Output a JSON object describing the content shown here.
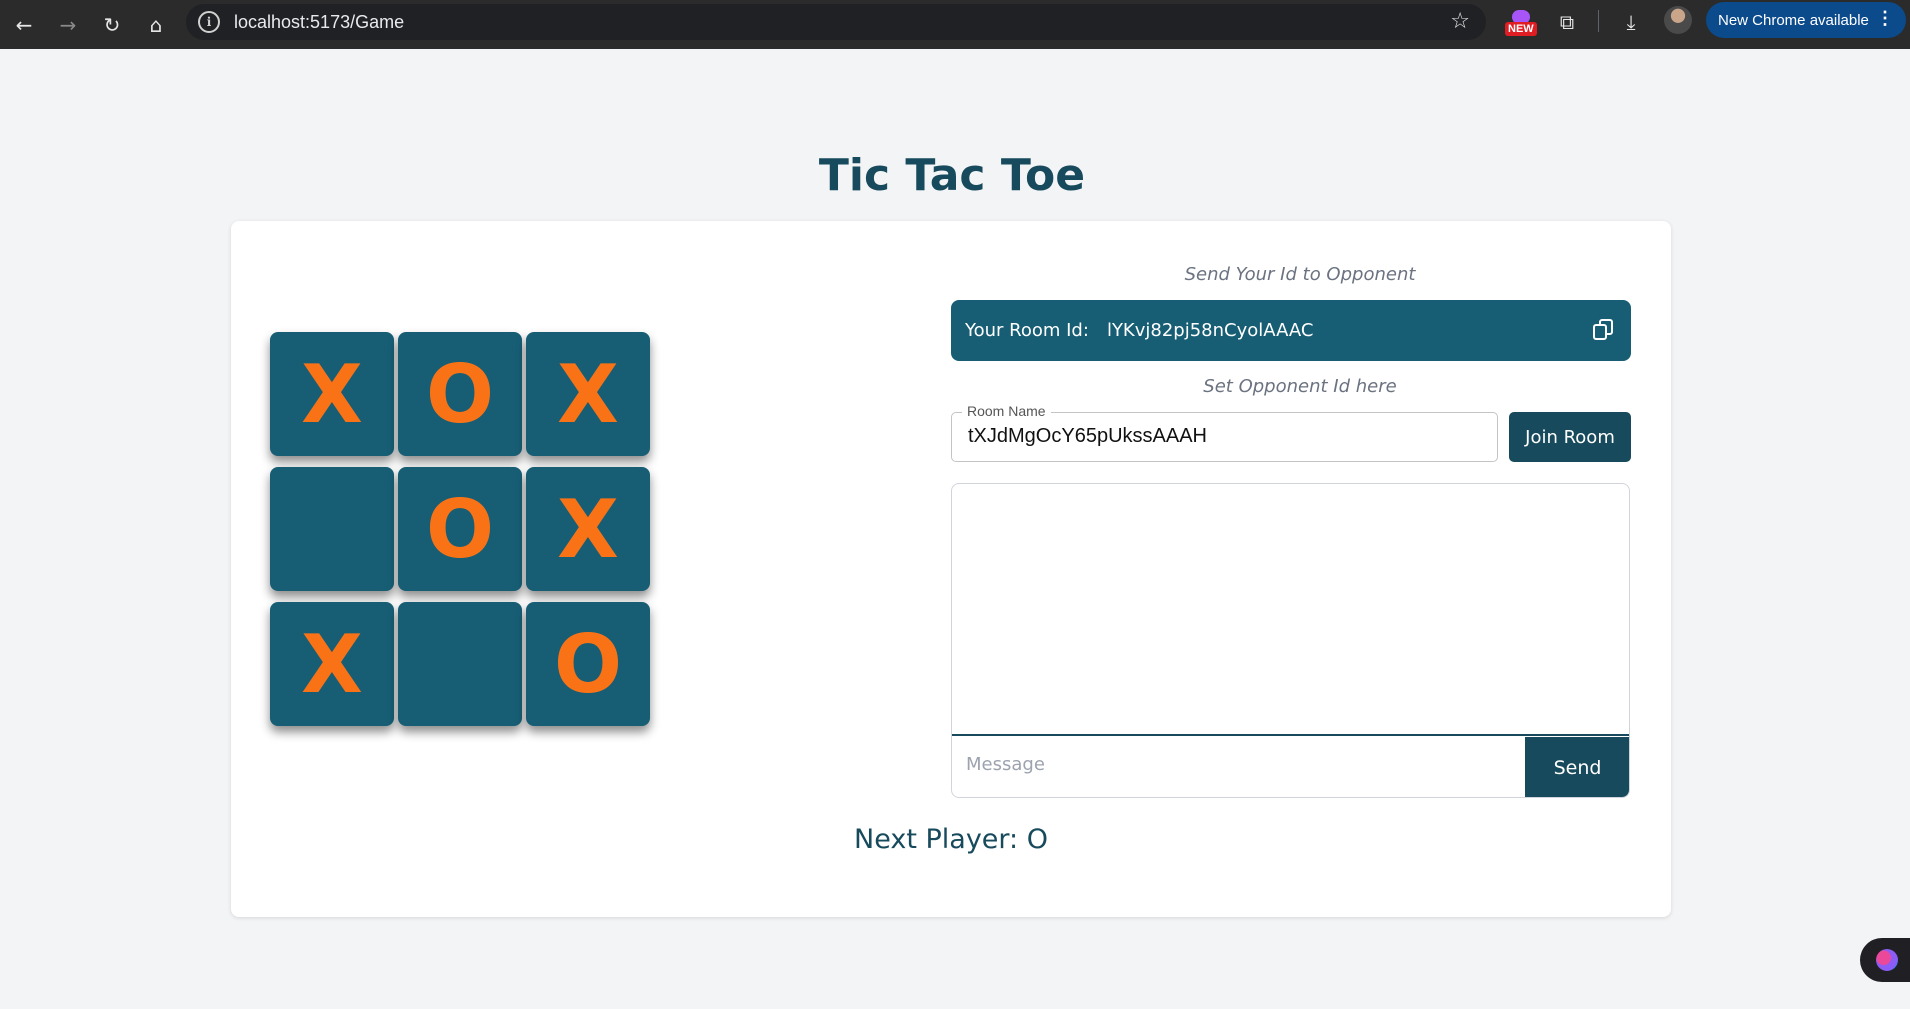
{
  "browser": {
    "url": "localhost:5173/Game",
    "new_badge": "NEW",
    "update_label": "New Chrome available",
    "update_more": "⋮",
    "icons": {
      "back": "←",
      "forward": "→",
      "reload": "↻",
      "home": "⌂",
      "info": "i",
      "star": "☆",
      "extensions": "⧉",
      "download": "⤓"
    }
  },
  "page": {
    "title": "Tic Tac Toe",
    "send_id_hint": "Send Your Id to Opponent",
    "room_id_label": "Your Room Id:",
    "room_id_value": "lYKvj82pj58nCyolAAAC",
    "set_opponent_hint": "Set Opponent Id here",
    "room_name_label": "Room Name",
    "room_name_value": "tXJdMgOcY65pUkssAAAH",
    "join_button": "Join Room",
    "message_placeholder": "Message",
    "send_button": "Send",
    "next_player": "Next Player: O"
  },
  "board": {
    "cells": [
      "X",
      "O",
      "X",
      "",
      "O",
      "X",
      "X",
      "",
      "O"
    ]
  },
  "colors": {
    "tile": "#175e75",
    "mark": "#f97316",
    "primary": "#174a5c",
    "background": "#f3f4f6"
  }
}
